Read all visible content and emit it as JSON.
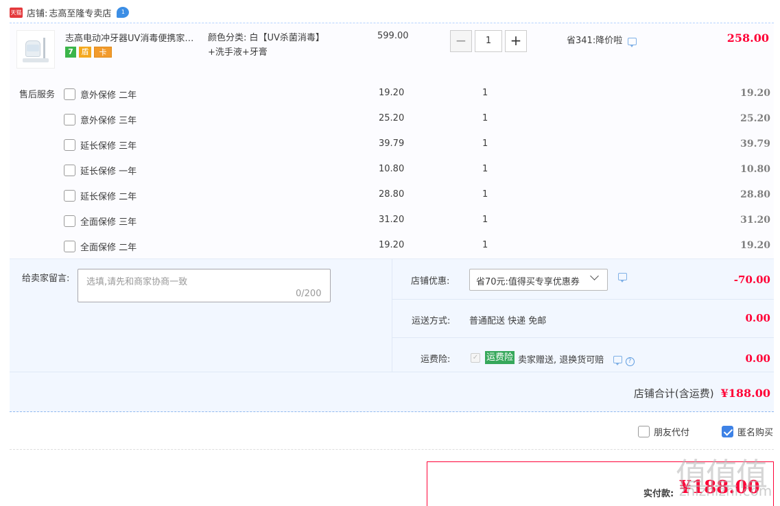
{
  "store": {
    "tmall_logo": "天猫",
    "label": "店铺:",
    "name": "志高至隆专卖店",
    "wangwang_badge": "1"
  },
  "product": {
    "title": "志高电动冲牙器UV消毒便携家…",
    "badges": [
      "7",
      "盾",
      "卡"
    ],
    "sku_line1": "颜色分类: 白【UV杀菌消毒】",
    "sku_line2": "+洗手液+牙膏",
    "unit_price": "599.00",
    "quantity": "1",
    "minus": "−",
    "plus": "+",
    "saving": "省341:降价啦",
    "total": "258.00"
  },
  "after_sales": {
    "label": "售后服务",
    "items": [
      {
        "name": "意外保修 二年",
        "price": "19.20",
        "qty": "1",
        "total": "19.20"
      },
      {
        "name": "意外保修 三年",
        "price": "25.20",
        "qty": "1",
        "total": "25.20"
      },
      {
        "name": "延长保修 三年",
        "price": "39.79",
        "qty": "1",
        "total": "39.79"
      },
      {
        "name": "延长保修 一年",
        "price": "10.80",
        "qty": "1",
        "total": "10.80"
      },
      {
        "name": "延长保修 二年",
        "price": "28.80",
        "qty": "1",
        "total": "28.80"
      },
      {
        "name": "全面保修 三年",
        "price": "31.20",
        "qty": "1",
        "total": "31.20"
      },
      {
        "name": "全面保修 二年",
        "price": "19.20",
        "qty": "1",
        "total": "19.20"
      }
    ]
  },
  "message": {
    "label": "给卖家留言:",
    "placeholder": "选填,请先和商家协商一致",
    "count": "0/200"
  },
  "coupon": {
    "label": "店铺优惠:",
    "selected": "省70元:值得买专享优惠券",
    "amount": "-70.00"
  },
  "shipping": {
    "label": "运送方式:",
    "value": "普通配送 快递 免邮",
    "amount": "0.00"
  },
  "insurance": {
    "label": "运费险:",
    "check": "✓",
    "tag": "运费险",
    "desc": "卖家赠送, 退换货可赔",
    "help": "?",
    "amount": "0.00"
  },
  "store_total": {
    "label": "店铺合计(含运费)",
    "value": "¥188.00"
  },
  "pay_options": {
    "friend_pay": "朋友代付",
    "anonymous": "匿名购买"
  },
  "payment": {
    "label": "实付款:",
    "amount": "¥188.00"
  },
  "watermark": {
    "text": "值值值",
    "site": "zhizhizhi.com"
  },
  "colors": {
    "accent_red": "#ff0036",
    "panel_blue": "#f2f7ff",
    "checkbox_blue": "#3e82e6",
    "insurance_green": "#36a85b"
  }
}
